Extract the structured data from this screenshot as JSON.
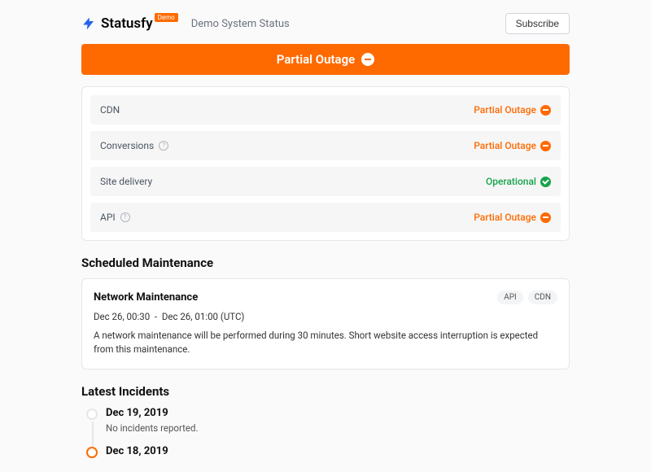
{
  "header": {
    "brand": "Statusfy",
    "badge": "Demo",
    "subtitle": "Demo System Status",
    "subscribe": "Subscribe"
  },
  "banner": {
    "status": "Partial Outage"
  },
  "systems": [
    {
      "name": "CDN",
      "help": false,
      "status": "Partial Outage",
      "state": "partial"
    },
    {
      "name": "Conversions",
      "help": true,
      "status": "Partial Outage",
      "state": "partial"
    },
    {
      "name": "Site delivery",
      "help": false,
      "status": "Operational",
      "state": "operational"
    },
    {
      "name": "API",
      "help": true,
      "status": "Partial Outage",
      "state": "partial"
    }
  ],
  "maintenance": {
    "heading": "Scheduled Maintenance",
    "title": "Network Maintenance",
    "tags": [
      "API",
      "CDN"
    ],
    "time_start": "Dec 26, 00:30",
    "time_sep": "-",
    "time_end": "Dec 26, 01:00 (UTC)",
    "description": "A network maintenance will be performed during 30 minutes. Short website access interruption is expected from this maintenance."
  },
  "incidents": {
    "heading": "Latest Incidents",
    "items": [
      {
        "date": "Dec 19, 2019",
        "text": "No incidents reported.",
        "active": false
      },
      {
        "date": "Dec 18, 2019",
        "text": "",
        "active": true
      }
    ]
  }
}
